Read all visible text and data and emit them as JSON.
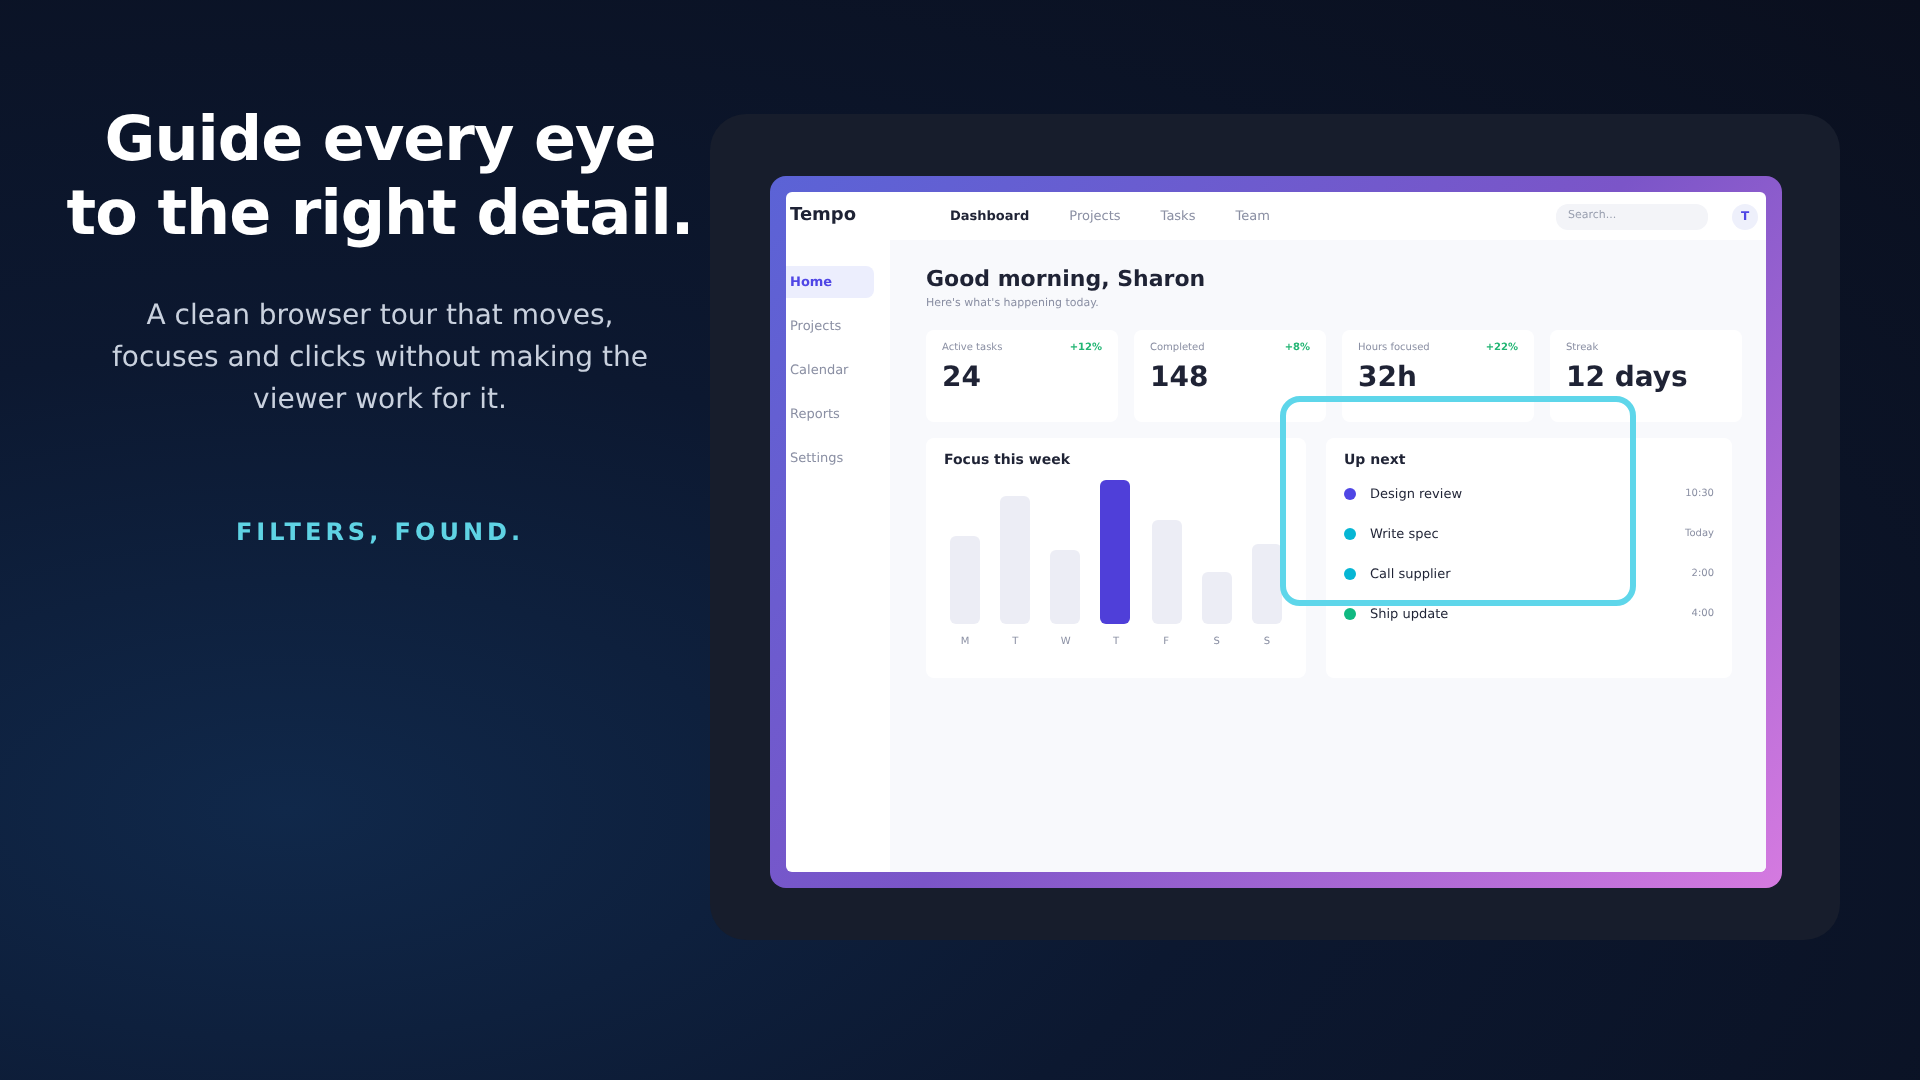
{
  "hero": {
    "headline": "Guide every eye to the right detail.",
    "body": "A clean browser tour that moves, focuses and clicks without making the viewer work for it.",
    "tagline": "FILTERS, FOUND."
  },
  "app": {
    "logo": "Tempo",
    "nav": [
      {
        "label": "Dashboard",
        "selected": true
      },
      {
        "label": "Projects",
        "selected": false
      },
      {
        "label": "Tasks",
        "selected": false
      },
      {
        "label": "Team",
        "selected": false
      }
    ],
    "search": {
      "placeholder": "Search..."
    },
    "avatar": "T",
    "sidebar": [
      {
        "label": "Home",
        "selected": true
      },
      {
        "label": "Projects",
        "selected": false
      },
      {
        "label": "Calendar",
        "selected": false
      },
      {
        "label": "Reports",
        "selected": false
      },
      {
        "label": "Settings",
        "selected": false
      }
    ],
    "greeting": "Good morning, Sharon",
    "subtitle": "Here's what's happening today.",
    "stats": [
      {
        "label": "Active tasks",
        "change": "+12%",
        "value": "24"
      },
      {
        "label": "Completed",
        "change": "+8%",
        "value": "148"
      },
      {
        "label": "Hours focused",
        "change": "+22%",
        "value": "32h"
      },
      {
        "label": "Streak",
        "value": "12 days"
      }
    ],
    "focus": {
      "title": "Focus this week",
      "days": [
        {
          "label": "M",
          "selected": false
        },
        {
          "label": "T",
          "selected": false
        },
        {
          "label": "W",
          "selected": false
        },
        {
          "label": "T",
          "selected": true
        },
        {
          "label": "F",
          "selected": false
        },
        {
          "label": "S",
          "selected": false
        },
        {
          "label": "S",
          "selected": false
        }
      ]
    },
    "up_next": {
      "title": "Up next",
      "items": [
        {
          "name": "Design review",
          "time": "10:30",
          "color": "#4f46e5"
        },
        {
          "name": "Write spec",
          "time": "Today",
          "color": "#06b6d4"
        },
        {
          "name": "Call supplier",
          "time": "2:00",
          "color": "#06b6d4"
        },
        {
          "name": "Ship update",
          "time": "4:00",
          "color": "#10b981"
        }
      ]
    }
  }
}
